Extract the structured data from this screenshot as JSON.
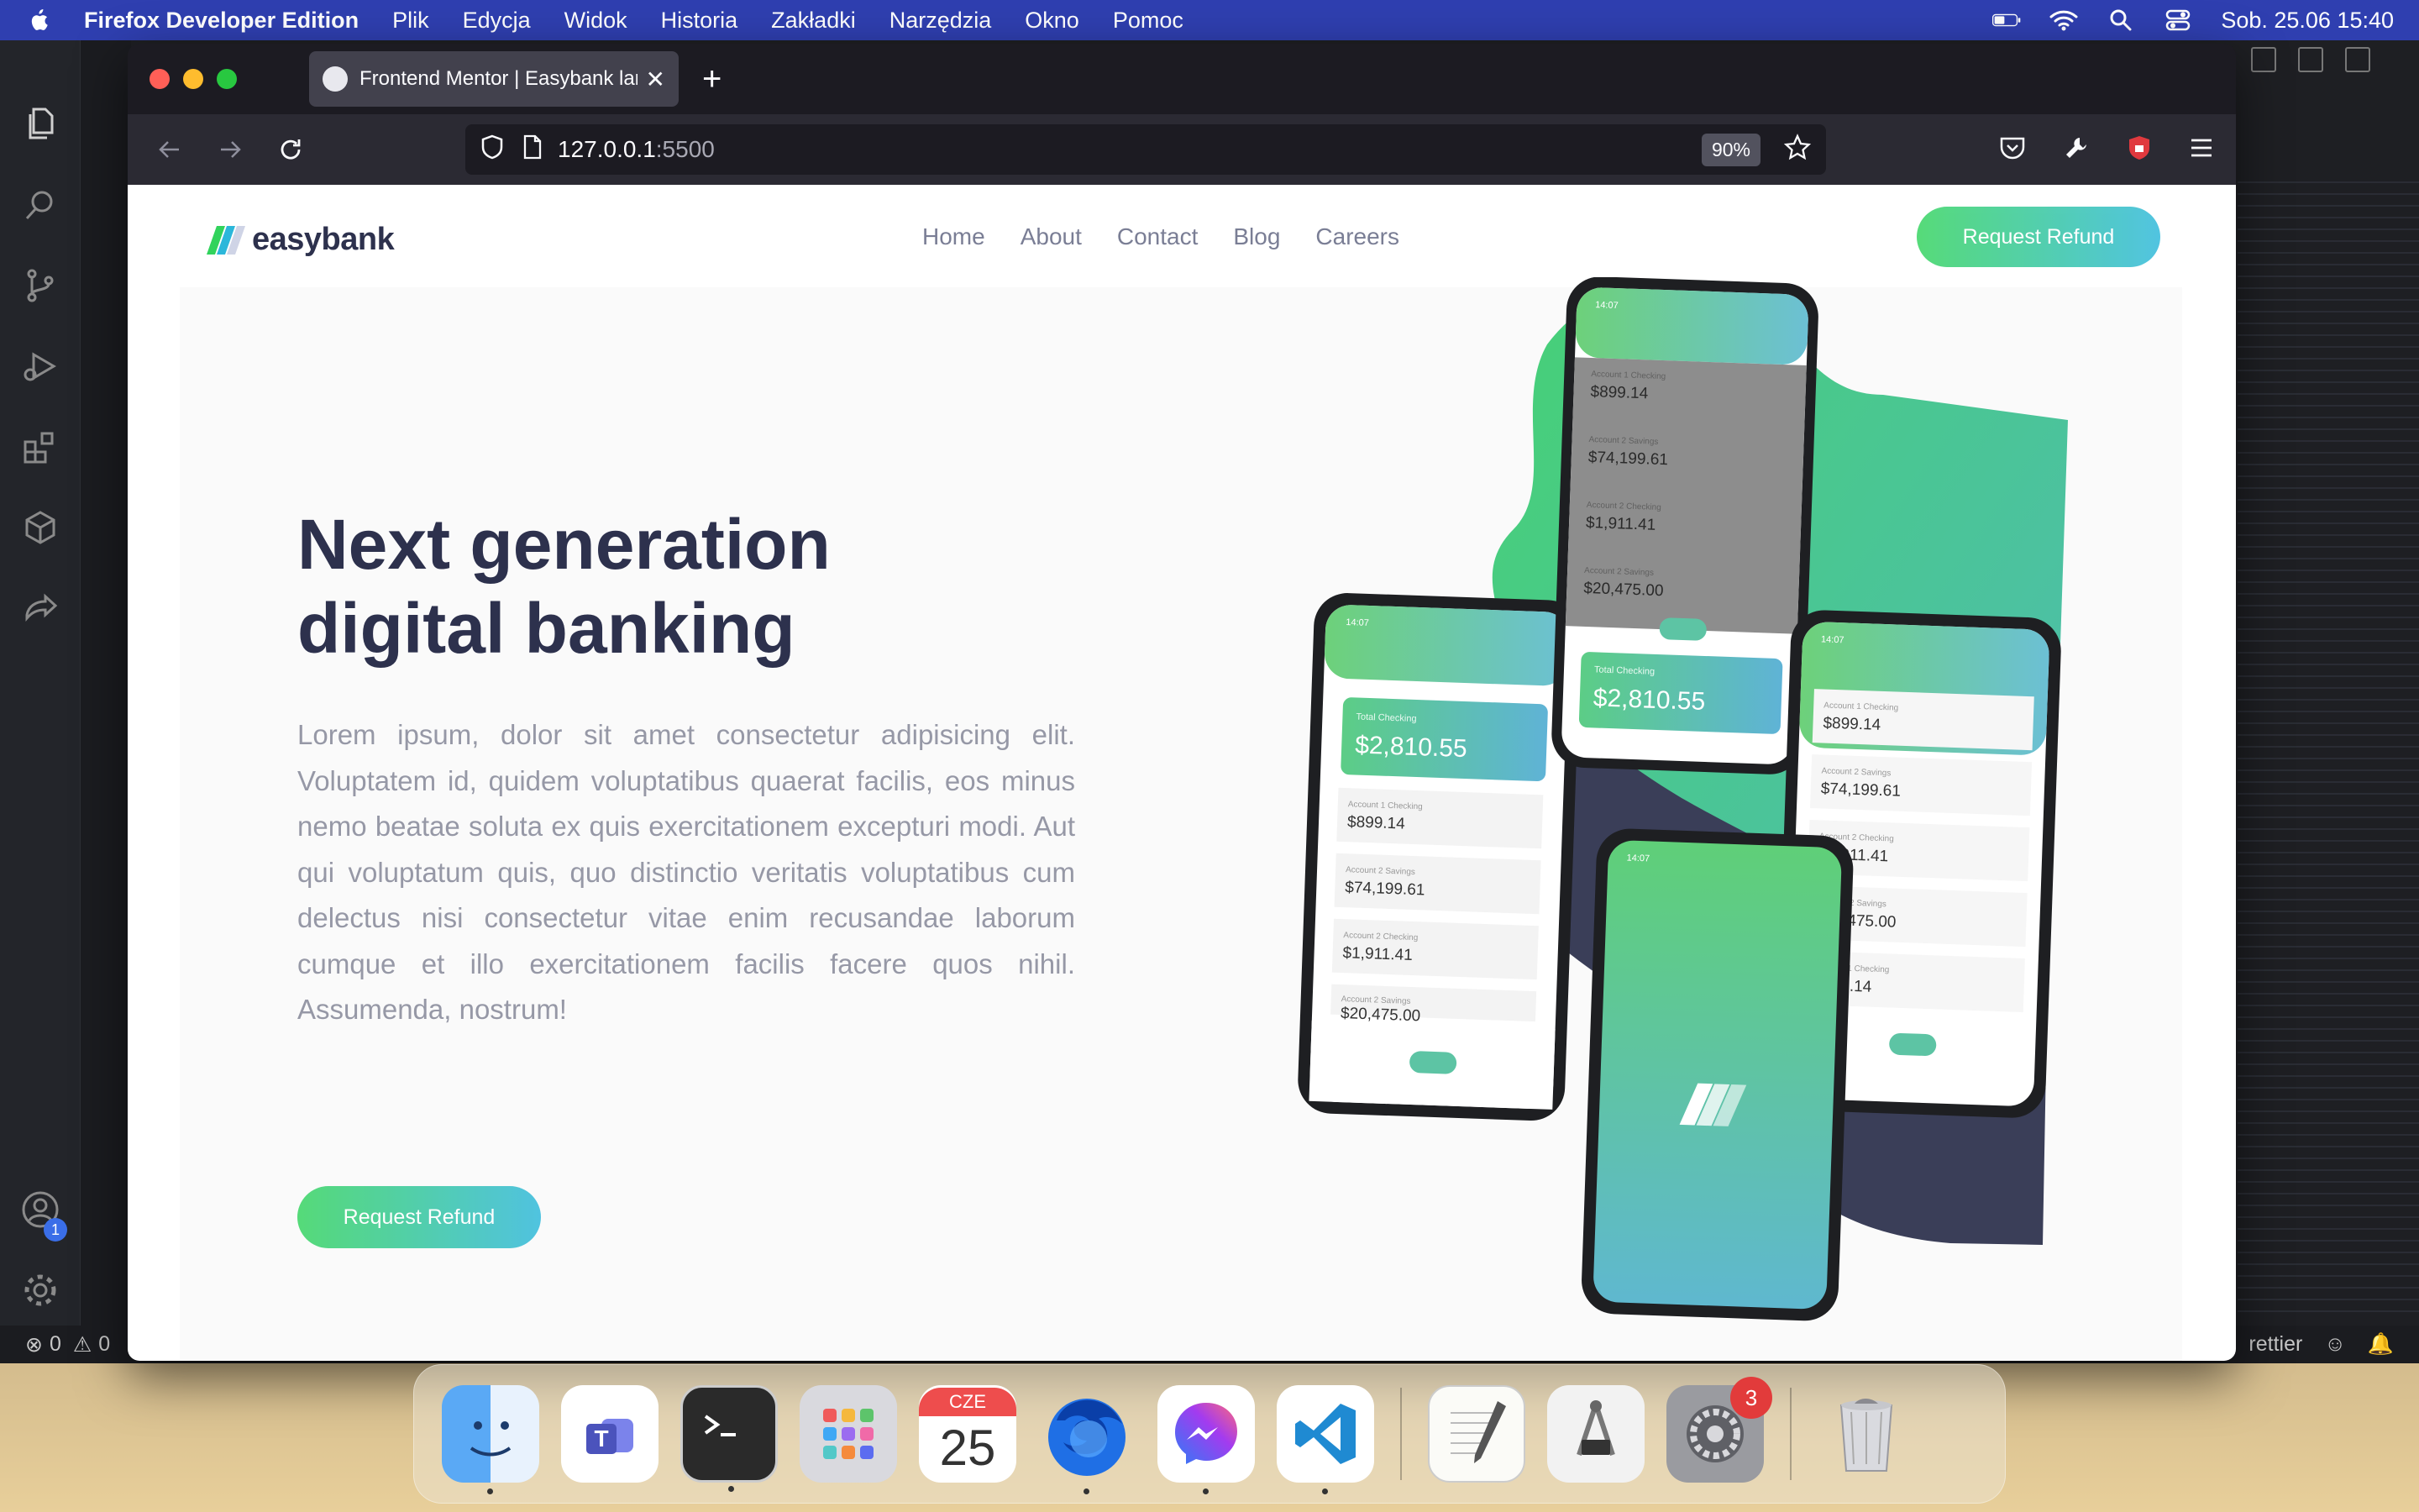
{
  "menubar": {
    "app_name": "Firefox Developer Edition",
    "items": [
      "Plik",
      "Edycja",
      "Widok",
      "Historia",
      "Zakładki",
      "Narzędzia",
      "Okno",
      "Pomoc"
    ],
    "datetime": "Sob. 25.06  15:40"
  },
  "vscode": {
    "status_errors": "0",
    "status_warnings": "0",
    "status_right": "rettier",
    "accounts_badge": "1"
  },
  "firefox": {
    "tab_title": "Frontend Mentor | Easybank landing page",
    "url_host": "127.0.0.1",
    "url_port": ":5500",
    "zoom": "90%"
  },
  "page": {
    "logo_text": "easybank",
    "nav": [
      "Home",
      "About",
      "Contact",
      "Blog",
      "Careers"
    ],
    "header_button": "Request Refund",
    "hero_title_line1": "Next generation",
    "hero_title_line2": "digital banking",
    "hero_text": "Lorem ipsum, dolor sit amet consectetur adipisicing elit. Voluptatem id, quidem voluptatibus quaerat facilis, eos minus nemo beatae soluta ex quis exercitationem excepturi modi. Aut qui voluptatum quis, quo distinctio veritatis voluptatibus cum delectus nisi consectetur vitae enim recusandae laborum cumque et illo exercitationem facilis facere quos nihil. Assumenda, nostrum!",
    "hero_button": "Request Refund",
    "phone_time": "14:07",
    "total_label": "Total Checking",
    "total_value": "$2,810.55",
    "accounts": [
      {
        "label": "Account 1 Checking",
        "value": "$899.14"
      },
      {
        "label": "Account 2 Savings",
        "value": "$74,199.61"
      },
      {
        "label": "Account 2 Checking",
        "value": "$1,911.41"
      },
      {
        "label": "Account 2 Savings",
        "value": "$20,475.00"
      },
      {
        "label": "Account 1 Checking",
        "value": "$899.14"
      }
    ],
    "partial_value": "$20,475.00"
  },
  "dock": {
    "calendar_month": "CZE",
    "calendar_day": "25",
    "settings_badge": "3"
  },
  "colors": {
    "menubar": "#2f3fb0",
    "brand_dark": "#2d314d",
    "gradient_green": "#31d35c",
    "gradient_cyan": "#2bb7da"
  }
}
